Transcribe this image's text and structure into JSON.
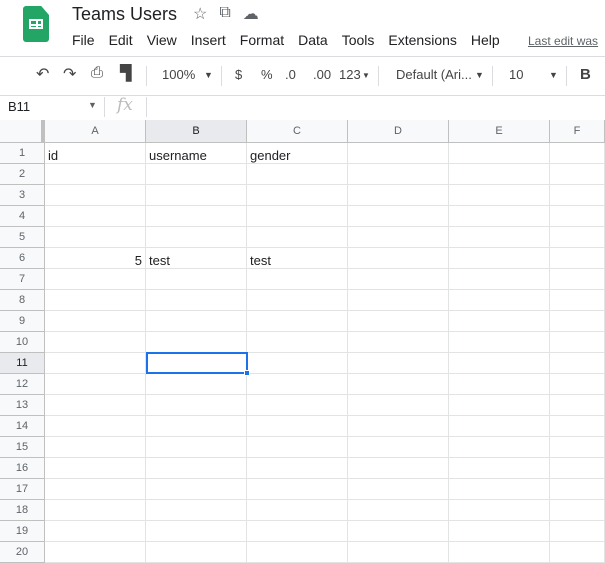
{
  "doc": {
    "title": "Teams Users",
    "last_edit": "Last edit was"
  },
  "menu": [
    "File",
    "Edit",
    "View",
    "Insert",
    "Format",
    "Data",
    "Tools",
    "Extensions",
    "Help"
  ],
  "toolbar": {
    "zoom": "100%",
    "currency": "$",
    "percent": "%",
    "dec_less": ".0",
    "dec_more": ".00",
    "format": "123",
    "font": "Default (Ari...",
    "size": "10",
    "bold": "B"
  },
  "namebox": "B11",
  "fx": "fx",
  "columns": [
    "A",
    "B",
    "C",
    "D",
    "E",
    "F"
  ],
  "rows": 20,
  "selected": {
    "col": 1,
    "row": 11
  },
  "cells": {
    "1": [
      "id",
      "username",
      "gender"
    ],
    "6": [
      "5",
      "test",
      "test"
    ]
  }
}
